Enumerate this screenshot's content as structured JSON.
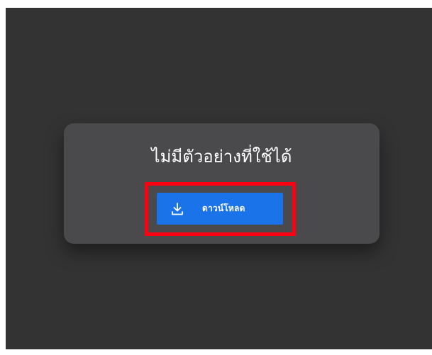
{
  "preview_card": {
    "message": "ไม่มีตัวอย่างที่ใช้ได้",
    "download_button": {
      "label": "ดาวน์โหลด",
      "icon": "download-icon"
    }
  },
  "colors": {
    "viewer_background": "#333333",
    "card_background": "#4a494b",
    "button_primary": "#1a73e8",
    "highlight_border": "#ff0010",
    "text": "#ffffff"
  }
}
